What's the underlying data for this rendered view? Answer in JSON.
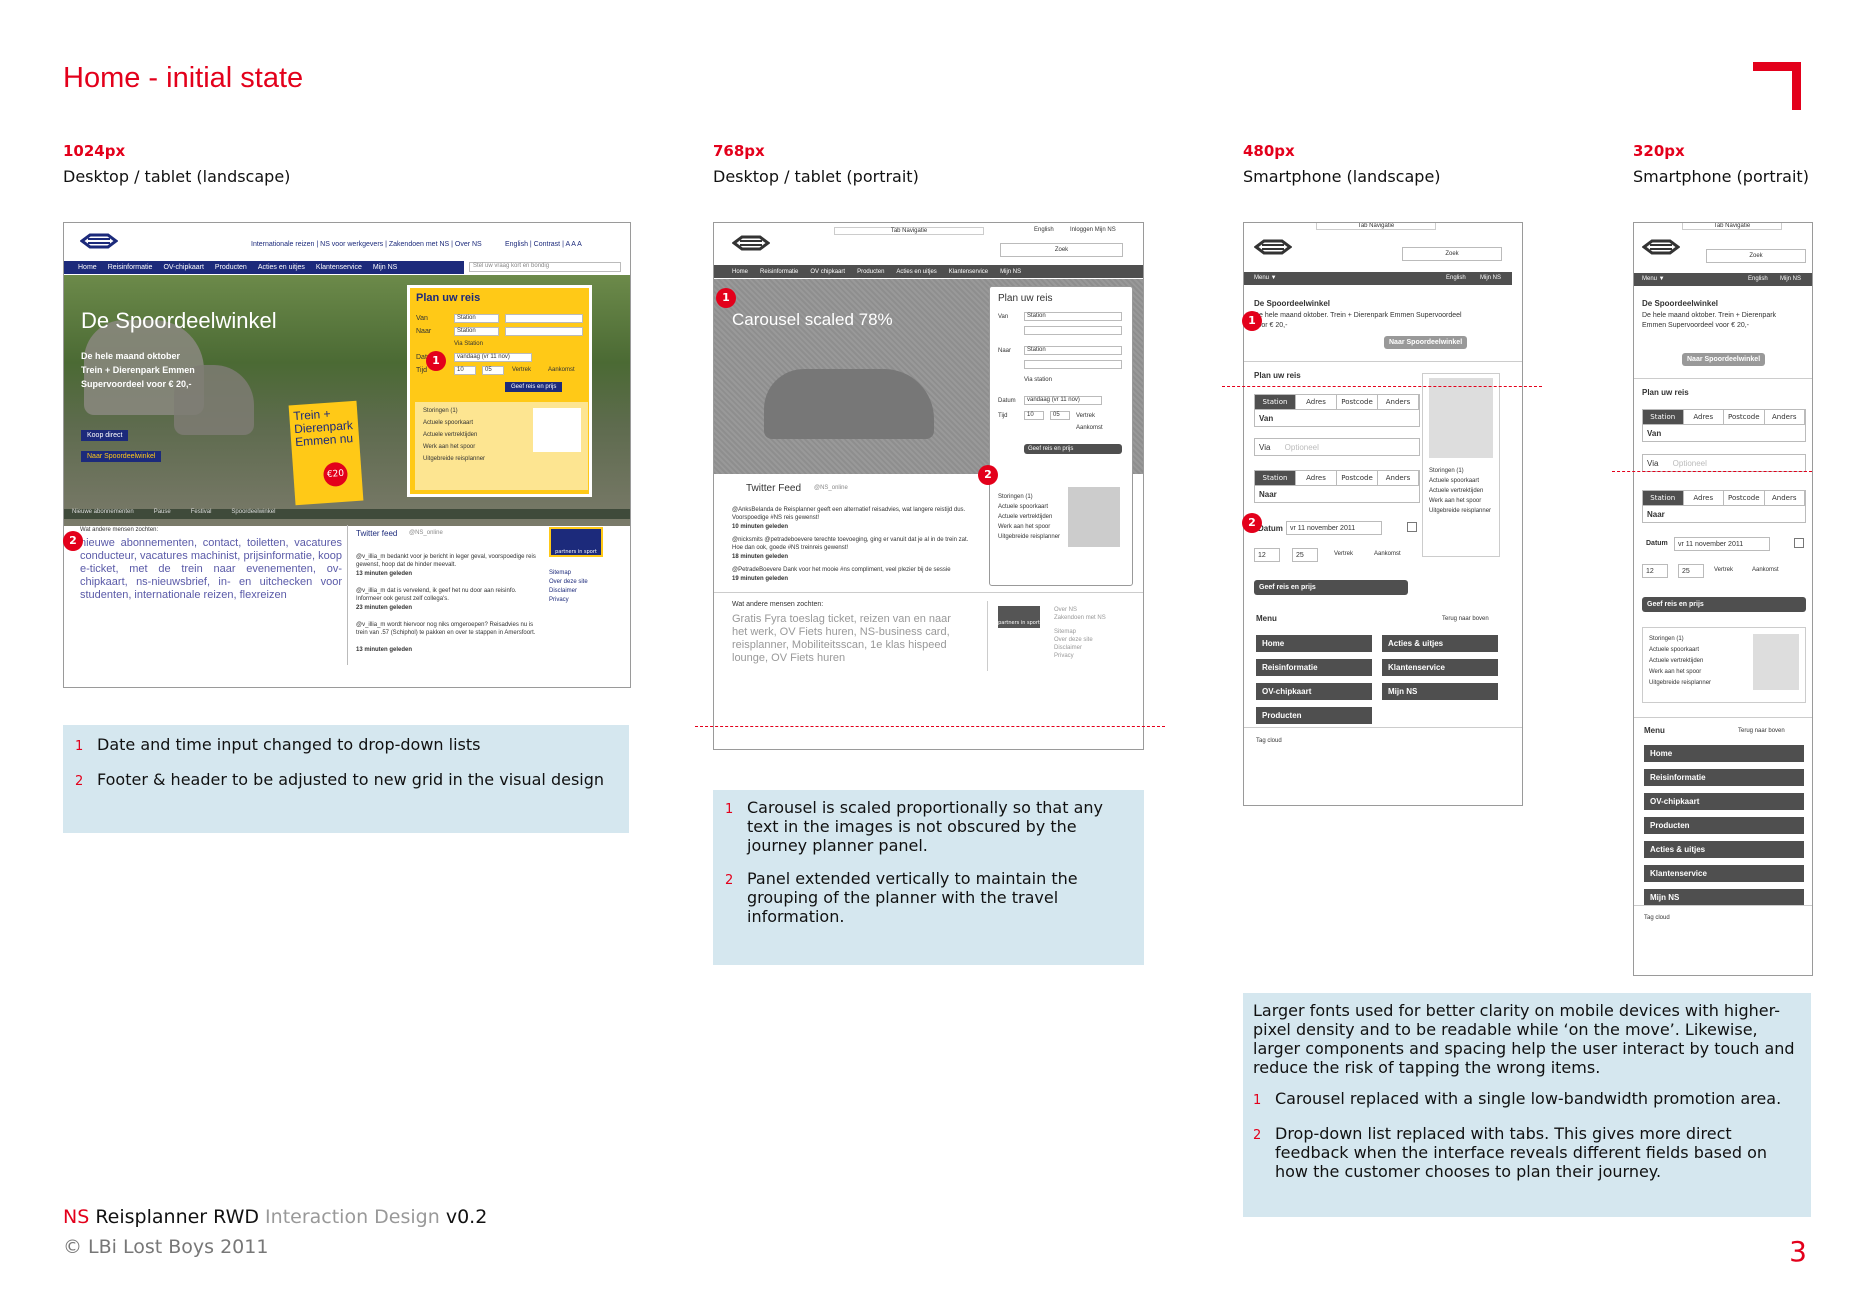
{
  "page": {
    "title": "Home - initial state",
    "footer_ns": "NS",
    "footer_reis": "Reisplanner RWD",
    "footer_id": "Interaction Design",
    "footer_ver": "v0.2",
    "footer_copy": "© LBi Lost Boys 2011",
    "page_number": "3"
  },
  "viewports": [
    {
      "size": "1024px",
      "label": "Desktop / tablet (landscape)"
    },
    {
      "size": "768px",
      "label": "Desktop / tablet (portrait)"
    },
    {
      "size": "480px",
      "label": "Smartphone (landscape)"
    },
    {
      "size": "320px",
      "label": "Smartphone (portrait)"
    }
  ],
  "notes": {
    "n1": [
      {
        "num": "1",
        "text": "Date and time input changed to drop-down lists"
      },
      {
        "num": "2",
        "text": "Footer & header to be adjusted to new grid in the visual design"
      }
    ],
    "n2": [
      {
        "num": "1",
        "text": "Carousel is scaled proportionally so that any text in the images is not obscured by the journey planner panel."
      },
      {
        "num": "2",
        "text": "Panel extended vertically to maintain the grouping of the planner with the travel information."
      }
    ],
    "n3_intro": "Larger fonts used for better clarity on mobile devices with higher-pixel density and to be readable while ‘on the move’. Likewise, larger components and spacing help the user interact by touch and reduce the risk of tapping the wrong items.",
    "n3": [
      {
        "num": "1",
        "text": "Carousel replaced with a single low-bandwidth promotion area."
      },
      {
        "num": "2",
        "text": "Drop-down list replaced with tabs. This gives more direct feedback when the interface reveals different fields based on how the customer chooses to plan their journey."
      }
    ]
  },
  "mock1024": {
    "toplinks": "Internationale reizen  |  NS voor werkgevers  |  Zakendoen met NS  |  Over NS",
    "toplinks2": "English  |  Contrast  |  A A A",
    "search_placeholder": "Stel uw vraag kort en bondig",
    "nav": [
      "Home",
      "Reisinformatie",
      "OV-chipkaart",
      "Producten",
      "Acties en uitjes",
      "Klantenservice",
      "Mijn NS"
    ],
    "hero_title": "De Spoordeelwinkel",
    "hero_sub1": "De hele maand oktober",
    "hero_sub2": "Trein + Dierenpark Emmen",
    "hero_sub3": "Supervoordeel voor € 20,-",
    "koop": "Koop direct",
    "naar": "Naar Spoordeelwinkel",
    "promo_title": "Trein + Dierenpark Emmen nu",
    "promo_price": "€20",
    "plan_title": "Plan uw reis",
    "van": "Van",
    "naar_label": "Naar",
    "station": "Station",
    "via": "Via Station",
    "datum": "Datum",
    "datum_val": "vandaag (vr 11 nov)",
    "tijd": "Tijd",
    "hh": "10",
    "mm": "05",
    "vertrek": "Vertrek",
    "aankomst": "Aankomst",
    "geef": "Geef reis en prijs",
    "links": [
      "Storingen (1)",
      "Actuele spoorkaart",
      "Actuele vertrektijden",
      "Werk aan het spoor",
      "Uitgebreide reisplanner"
    ],
    "tabsbar": [
      "Nieuwe abonnementen",
      "Pause",
      "Festival",
      "Spoordeelwinkel"
    ],
    "searched_title": "Wat andere mensen zochten:",
    "cloud": "nieuwe abonnementen, contact, toiletten, vacatures conducteur, vacatures machinist, prijsinformatie, koop e-ticket, met de trein naar evenementen, ov-chipkaart, ns-nieuwsbrief, in- en uitchecken voor studenten, internationale reizen, flexreizen",
    "twitter": "Twitter feed",
    "twitter_handle": "@NS_online",
    "tw1": "@v_illia_m bedankt voor je bericht in leger geval, voorspoedige reis gewenst, hoop dat de hinder meevalt.",
    "tw1t": "13 minuten geleden",
    "tw2": "@v_illia_m dat is vervelend, ik geef het nu door aan reisinfo. Informeer ook gerust zelf collega's.",
    "tw2t": "23 minuten geleden",
    "tw3": "@v_illia_m wordt hiervoor nog niks omgeroepen? Reisadvies nu is trein van .57 (Schiphol) te pakken en over te stappen in Amersfoort.",
    "tw3t": "13 minuten geleden",
    "partners": "partners in sport",
    "flinks": [
      "Sitemap",
      "Over deze site",
      "Disclaimer",
      "Privacy"
    ]
  },
  "mock768": {
    "tabnav": "Tab Navigatie",
    "english": "English",
    "login": "Inloggen Mijn NS",
    "zoek": "Zoek",
    "nav": [
      "Home",
      "Reisinformatie",
      "OV chipkaart",
      "Producten",
      "Acties en uitjes",
      "Klantenservice",
      "Mijn NS"
    ],
    "carousel": "Carousel scaled 78%",
    "plan": "Plan uw reis",
    "van": "Van",
    "naar": "Naar",
    "station": "Station",
    "via": "Via station",
    "datum": "Datum",
    "datum_val": "vandaag (vr 11 nov)",
    "tijd": "Tijd",
    "hh": "10",
    "mm": "05",
    "vertrek": "Vertrek",
    "aankomst": "Aankomst",
    "geef": "Geef reis en prijs",
    "links": [
      "Storingen (1)",
      "Actuele spoorkaart",
      "Actuele vertrektijden",
      "Werk aan het spoor",
      "Uitgebreide reisplanner"
    ],
    "twitter": "Twitter Feed",
    "twitter_handle": "@NS_online",
    "tw1": "@AnksBelanda de Reisplanner geeft een alternatief reisadvies, wat langere reistijd dus. Voorspoedige #NS reis gewenst!",
    "tw1t": "10 minuten geleden",
    "tw2": "@nicksmits @petradeboevere terechte toevoeging, ging er vanuit dat je al in de trein zat. Hoe dan ook, goede #NS treinreis gewenst!",
    "tw2t": "18 minuten geleden",
    "tw3": "@PetradeBoevere Dank voor het mooie #ns compliment, veel plezier bij de sessie",
    "tw3t": "19 minuten geleden",
    "searched": "Wat andere mensen zochten:",
    "cloud": "Gratis Fyra toeslag ticket, reizen van en naar het werk, OV Fiets huren, NS-business card, reisplanner, Mobiliteitsscan, 1e klas hispeed lounge, OV Fiets huren",
    "partners": "partners in sport",
    "flinks": [
      "Over NS",
      "Zakendoen met NS",
      "Sitemap",
      "Over deze site",
      "Disclaimer",
      "Privacy"
    ]
  },
  "mock480": {
    "tabnav": "Tab Navigatie",
    "zoek": "Zoek",
    "menu": "Menu ▼",
    "english": "English",
    "mijnns": "Mijn NS",
    "promo_title": "De Spoordeelwinkel",
    "promo_text": "De hele maand oktober. Trein + Dierenpark Emmen Supervoordeel voor € 20,-",
    "promo_btn": "Naar Spoordeelwinkel",
    "plan": "Plan uw reis",
    "tabs": [
      "Station",
      "Adres",
      "Postcode",
      "Anders"
    ],
    "van": "Van",
    "via": "Via",
    "via_ph": "Optioneel",
    "naar": "Naar",
    "datum": "Datum",
    "datum_val": "vr 11 november 2011",
    "hh": "12",
    "mm": "25",
    "vertrek": "Vertrek",
    "aankomst": "Aankomst",
    "geef": "Geef reis en prijs",
    "links": [
      "Storingen (1)",
      "Actuele spoorkaart",
      "Actuele vertrektijden",
      "Werk aan het spoor",
      "Uitgebreide reisplanner"
    ],
    "menu_title": "Menu",
    "terug": "Terug naar boven",
    "menu_left": [
      "Home",
      "Reisinformatie",
      "OV-chipkaart",
      "Producten"
    ],
    "menu_right": [
      "Acties & uitjes",
      "Klantenservice",
      "Mijn NS"
    ],
    "tagcloud": "Tag cloud"
  },
  "mock320": {
    "tabnav": "Tab Navigatie",
    "zoek": "Zoek",
    "menu": "Menu ▼",
    "english": "English",
    "mijnns": "Mijn NS",
    "promo_title": "De Spoordeelwinkel",
    "promo_text": "De hele maand oktober. Trein + Dierenpark Emmen Supervoordeel voor € 20,-",
    "promo_btn": "Naar Spoordeelwinkel",
    "plan": "Plan uw reis",
    "tabs": [
      "Station",
      "Adres",
      "Postcode",
      "Anders"
    ],
    "van": "Van",
    "via": "Via",
    "via_ph": "Optioneel",
    "naar": "Naar",
    "datum": "Datum",
    "datum_val": "vr 11 november 2011",
    "hh": "12",
    "mm": "25",
    "vertrek": "Vertrek",
    "aankomst": "Aankomst",
    "geef": "Geef reis en prijs",
    "links": [
      "Storingen (1)",
      "Actuele spoorkaart",
      "Actuele vertrektijden",
      "Werk aan het spoor",
      "Uitgebreide reisplanner"
    ],
    "menu_title": "Menu",
    "terug": "Terug naar boven",
    "menu_items": [
      "Home",
      "Reisinformatie",
      "OV-chipkaart",
      "Producten",
      "Acties & uitjes",
      "Klantenservice",
      "Mijn NS"
    ],
    "tagcloud": "Tag cloud"
  },
  "badges": {
    "one": "1",
    "two": "2"
  },
  "colors": {
    "accent": "#e3001b",
    "ns_blue": "#1c2a7b",
    "ns_yellow": "#ffc917",
    "note_bg": "#d5e7ef",
    "dark": "#4f4f4f"
  }
}
